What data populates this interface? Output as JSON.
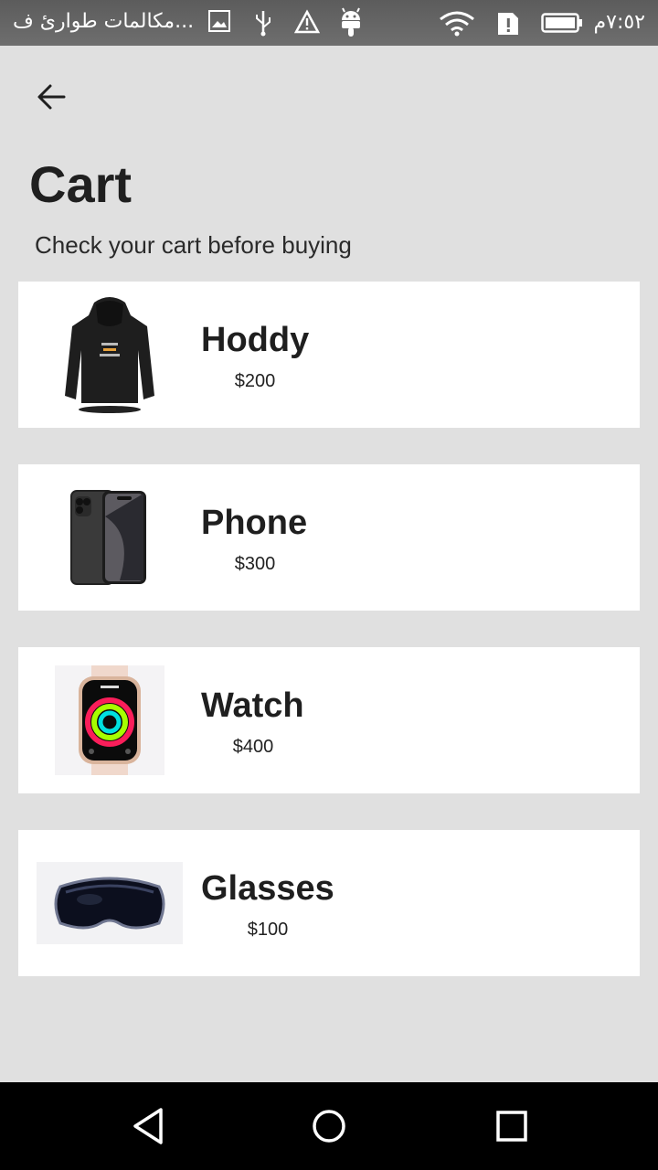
{
  "status_bar": {
    "time": "٧:٥٢م",
    "notification_text": "مكالمات طوارئ ف...",
    "icons": [
      "image-icon",
      "usb-icon",
      "warning-icon",
      "android-icon",
      "wifi-icon",
      "sim-alert-icon",
      "battery-icon"
    ]
  },
  "header": {
    "back_icon": "arrow-left-icon",
    "title": "Cart",
    "subtitle": "Check your cart before buying"
  },
  "cart": {
    "items": [
      {
        "name": "Hoddy",
        "price": "$200",
        "image": "hoodie-image"
      },
      {
        "name": "Phone",
        "price": "$300",
        "image": "phone-image"
      },
      {
        "name": "Watch",
        "price": "$400",
        "image": "watch-image"
      },
      {
        "name": "Glasses",
        "price": "$100",
        "image": "vr-glasses-image"
      }
    ]
  },
  "nav_bar": {
    "buttons": [
      "back-triangle-icon",
      "home-circle-icon",
      "recents-square-icon"
    ]
  }
}
